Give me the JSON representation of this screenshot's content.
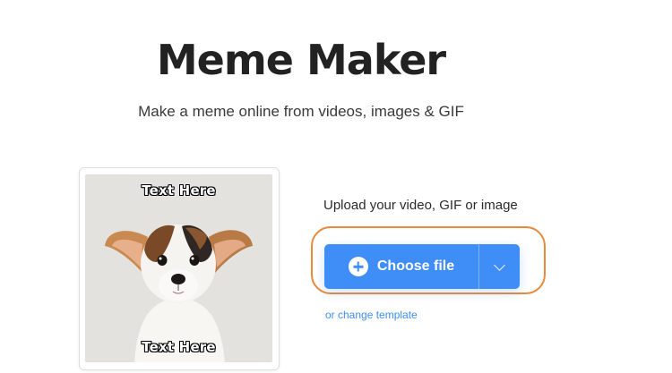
{
  "header": {
    "title": "Meme Maker",
    "subtitle": "Make a meme online from videos, images & GIF"
  },
  "preview": {
    "top_text": "Text Here",
    "bottom_text": "Text Here",
    "image_icon": "dog-photo"
  },
  "upload": {
    "label": "Upload your video, GIF or image",
    "button_label": "Choose file",
    "button_icon": "plus-circle-icon",
    "dropdown_icon": "chevron-down-icon",
    "change_template_link": "or change template"
  },
  "colors": {
    "accent": "#3f8ef8",
    "highlight": "#e88a3c"
  }
}
